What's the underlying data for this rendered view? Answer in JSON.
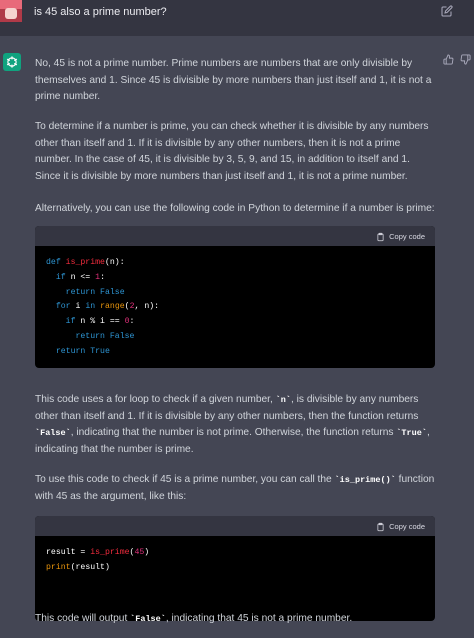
{
  "user": {
    "message": "is 45 also a prime number?"
  },
  "assistant": {
    "p1": "No, 45 is not a prime number. Prime numbers are numbers that are only divisible by themselves and 1. Since 45 is divisible by more numbers than just itself and 1, it is not a prime number.",
    "p2": "To determine if a number is prime, you can check whether it is divisible by any numbers other than itself and 1. If it is divisible by any other numbers, then it is not a prime number. In the case of 45, it is divisible by 3, 5, 9, and 15, in addition to itself and 1. Since it is divisible by more numbers than just itself and 1, it is not a prime number.",
    "p3": "Alternatively, you can use the following code in Python to determine if a number is prime:",
    "code1": {
      "copy_label": "Copy code",
      "l1_kw": "def ",
      "l1_fn": "is_prime",
      "l1_rest": "(n):",
      "l2_kw": "if",
      "l2_mid": " n <= ",
      "l2_num": "1",
      "l2_end": ":",
      "l3_kw": "return",
      "l3_val": " False",
      "l4_kw": "for",
      "l4_mid": " i ",
      "l4_in": "in",
      "l4_sp": " ",
      "l4_bi": "range",
      "l4_p": "(",
      "l4_num": "2",
      "l4_end": ", n):",
      "l5_kw": "if",
      "l5_mid": " n % i == ",
      "l5_num": "0",
      "l5_end": ":",
      "l6_kw": "return",
      "l6_val": " False",
      "l7_kw": "return",
      "l7_val": " True"
    },
    "p4_a": "This code uses a for loop to check if a given number, ",
    "p4_code1": "`n`",
    "p4_b": ", is divisible by any numbers other than itself and 1. If it is divisible by any other numbers, then the function returns ",
    "p4_code2": "`False`",
    "p4_c": ", indicating that the number is not prime. Otherwise, the function returns ",
    "p4_code3": "`True`",
    "p4_d": ", indicating that the number is prime.",
    "p5_a": "To use this code to check if 45 is a prime number, you can call the ",
    "p5_code": "`is_prime()`",
    "p5_b": " function with 45 as the argument, like this:",
    "code2": {
      "copy_label": "Copy code",
      "l1_pre": "result = ",
      "l1_fn": "is_prime",
      "l1_p": "(",
      "l1_num": "45",
      "l1_end": ")",
      "l2_bi": "print",
      "l2_end": "(result)"
    },
    "p6_a": "This code will output ",
    "p6_code": "`False`",
    "p6_b": ", indicating that 45 is not a prime number."
  }
}
